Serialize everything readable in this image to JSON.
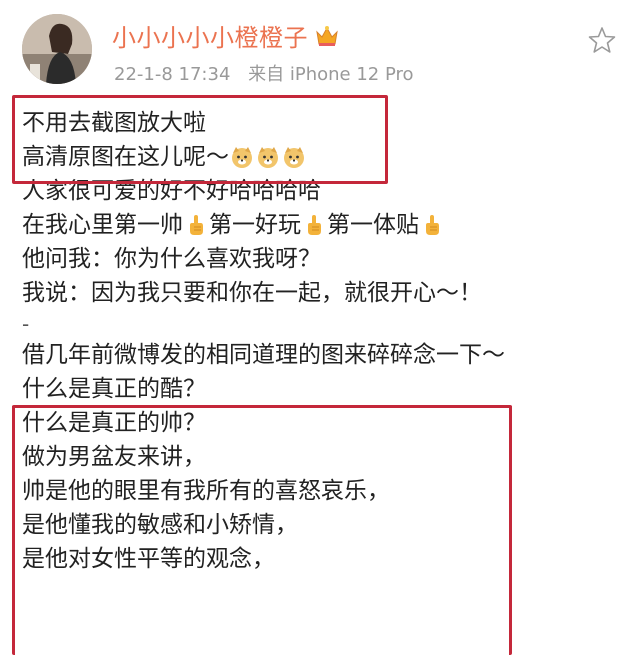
{
  "header": {
    "username": "小小小小小橙橙子",
    "timestamp": "22-1-8 17:34",
    "source": "来自 iPhone 12 Pro",
    "badge_icon": "crown-badge-icon",
    "favorite_icon": "star-outline-icon"
  },
  "post": {
    "lines": [
      {
        "text": "不用去截图放大啦"
      },
      {
        "text": "高清原图在这儿呢～",
        "emoji_after": 3
      },
      {
        "text": "人家很可爱的好不好哈哈哈哈"
      },
      {
        "segments": [
          "在我心里第一帅",
          "第一好玩",
          "第一体贴"
        ]
      },
      {
        "text": "他问我：你为什么喜欢我呀？"
      },
      {
        "text": "我说：因为我只要和你在一起，就很开心～！"
      },
      {
        "text": "-"
      },
      {
        "text": "借几年前微博发的相同道理的图来碎碎念一下～"
      },
      {
        "text": "什么是真正的酷？"
      },
      {
        "text": "什么是真正的帅？"
      },
      {
        "text": "做为男盆友来讲，"
      },
      {
        "text": "帅是他的眼里有我所有的喜怒哀乐，"
      },
      {
        "text": "是他懂我的敏感和小矫情，"
      },
      {
        "text": "是他对女性平等的观念，"
      }
    ]
  },
  "colors": {
    "username": "#eb7350",
    "meta": "#999999",
    "highlight_border": "#c4283a",
    "text": "#222222"
  }
}
